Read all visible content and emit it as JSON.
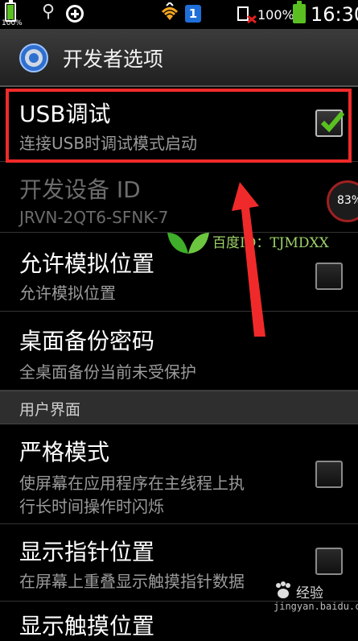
{
  "status_bar": {
    "battery_left_pct": "100%",
    "notification_count": "1",
    "battery_right_pct": "100%",
    "time": "16:30"
  },
  "header": {
    "title": "开发者选项"
  },
  "settings": [
    {
      "title": "USB调试",
      "subtitle": "连接USB时调试模式启动",
      "checked": true
    },
    {
      "title": "开发设备 ID",
      "subtitle": "JRVN-2QT6-SFNK-7",
      "enabled": false
    },
    {
      "title": "允许模拟位置",
      "subtitle": "允许模拟位置",
      "checked": false
    },
    {
      "title": "桌面备份密码",
      "subtitle": "全桌面备份当前未受保护"
    }
  ],
  "section": {
    "label": "用户界面"
  },
  "settings_ui": [
    {
      "title": "严格模式",
      "subtitle_line1": "使屏幕在应用程序在主线程上执",
      "subtitle_line2": "行长时间操作时闪烁",
      "checked": false
    },
    {
      "title": "显示指针位置",
      "subtitle": "在屏幕上重叠显示触摸指针数据",
      "checked": false
    },
    {
      "title": "显示触摸位置"
    }
  ],
  "overlay": {
    "badge_pct": "83%",
    "watermark": "百度ID：TJMDXX",
    "corner_brand": "经验",
    "corner_url": "jingyan.baidu.com"
  },
  "colors": {
    "accent_red": "#f02a2a",
    "check_green": "#5ac021"
  }
}
